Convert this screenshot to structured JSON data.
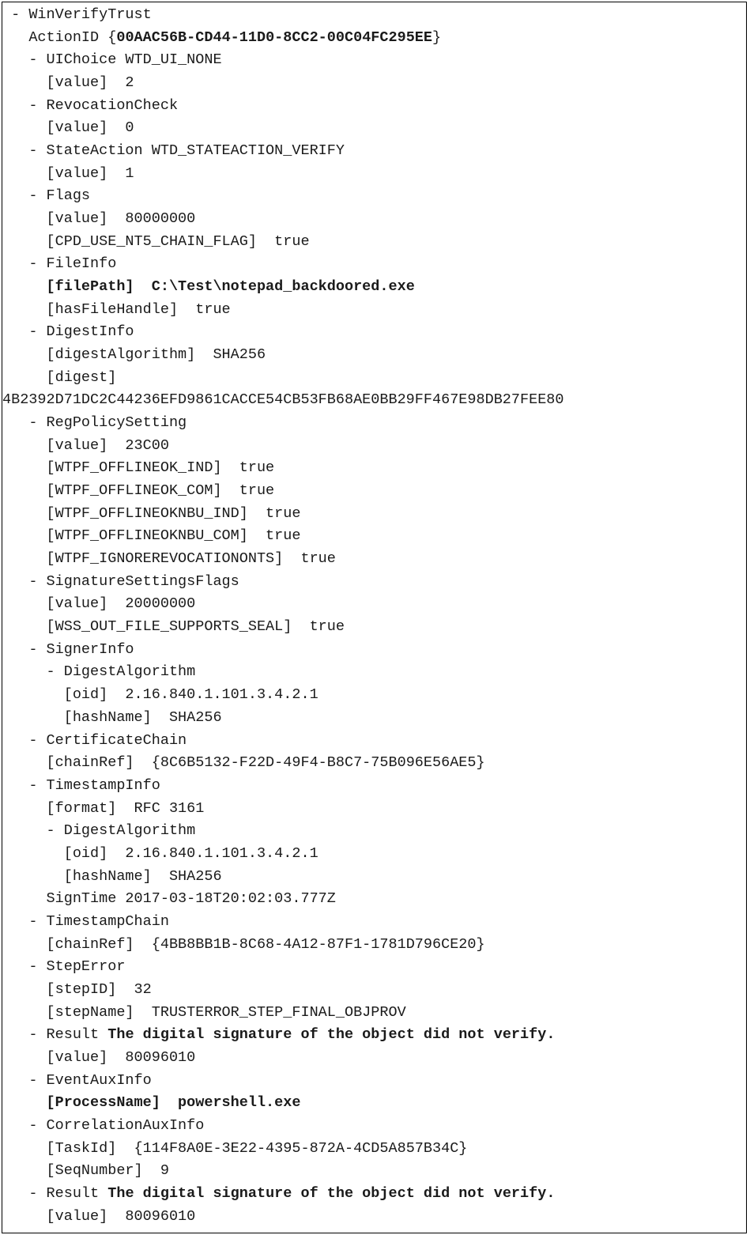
{
  "lines": [
    {
      "indent": 0,
      "segments": [
        {
          "t": "- WinVerifyTrust",
          "b": false
        }
      ]
    },
    {
      "indent": 1,
      "segments": [
        {
          "t": "ActionID {",
          "b": false
        },
        {
          "t": "00AAC56B-CD44-11D0-8CC2-00C04FC295EE",
          "b": true
        },
        {
          "t": "}",
          "b": false
        }
      ]
    },
    {
      "indent": 1,
      "segments": [
        {
          "t": "- UIChoice WTD_UI_NONE",
          "b": false
        }
      ]
    },
    {
      "indent": 2,
      "segments": [
        {
          "t": "[value]  2",
          "b": false
        }
      ]
    },
    {
      "indent": 1,
      "segments": [
        {
          "t": "- RevocationCheck",
          "b": false
        }
      ]
    },
    {
      "indent": 2,
      "segments": [
        {
          "t": "[value]  0",
          "b": false
        }
      ]
    },
    {
      "indent": 1,
      "segments": [
        {
          "t": "- StateAction WTD_STATEACTION_VERIFY",
          "b": false
        }
      ]
    },
    {
      "indent": 2,
      "segments": [
        {
          "t": "[value]  1",
          "b": false
        }
      ]
    },
    {
      "indent": 1,
      "segments": [
        {
          "t": "- Flags",
          "b": false
        }
      ]
    },
    {
      "indent": 2,
      "segments": [
        {
          "t": "[value]  80000000",
          "b": false
        }
      ]
    },
    {
      "indent": 2,
      "segments": [
        {
          "t": "[CPD_USE_NT5_CHAIN_FLAG]  true",
          "b": false
        }
      ]
    },
    {
      "indent": 1,
      "segments": [
        {
          "t": "- FileInfo",
          "b": false
        }
      ]
    },
    {
      "indent": 2,
      "segments": [
        {
          "t": "[filePath]  C:\\Test\\notepad_backdoored.exe",
          "b": true
        }
      ]
    },
    {
      "indent": 2,
      "segments": [
        {
          "t": "[hasFileHandle]  true",
          "b": false
        }
      ]
    },
    {
      "indent": 1,
      "segments": [
        {
          "t": "- DigestInfo",
          "b": false
        }
      ]
    },
    {
      "indent": 2,
      "segments": [
        {
          "t": "[digestAlgorithm]  SHA256",
          "b": false
        }
      ]
    },
    {
      "indent": 2,
      "segments": [
        {
          "t": "[digest]",
          "b": false
        }
      ]
    },
    {
      "indent": -1,
      "segments": [
        {
          "t": "4B2392D71DC2C44236EFD9861CACCE54CB53FB68AE0BB29FF467E98DB27FEE80",
          "b": false
        }
      ]
    },
    {
      "indent": 1,
      "segments": [
        {
          "t": "- RegPolicySetting",
          "b": false
        }
      ]
    },
    {
      "indent": 2,
      "segments": [
        {
          "t": "[value]  23C00",
          "b": false
        }
      ]
    },
    {
      "indent": 2,
      "segments": [
        {
          "t": "[WTPF_OFFLINEOK_IND]  true",
          "b": false
        }
      ]
    },
    {
      "indent": 2,
      "segments": [
        {
          "t": "[WTPF_OFFLINEOK_COM]  true",
          "b": false
        }
      ]
    },
    {
      "indent": 2,
      "segments": [
        {
          "t": "[WTPF_OFFLINEOKNBU_IND]  true",
          "b": false
        }
      ]
    },
    {
      "indent": 2,
      "segments": [
        {
          "t": "[WTPF_OFFLINEOKNBU_COM]  true",
          "b": false
        }
      ]
    },
    {
      "indent": 2,
      "segments": [
        {
          "t": "[WTPF_IGNOREREVOCATIONONTS]  true",
          "b": false
        }
      ]
    },
    {
      "indent": 1,
      "segments": [
        {
          "t": "- SignatureSettingsFlags",
          "b": false
        }
      ]
    },
    {
      "indent": 2,
      "segments": [
        {
          "t": "[value]  20000000",
          "b": false
        }
      ]
    },
    {
      "indent": 2,
      "segments": [
        {
          "t": "[WSS_OUT_FILE_SUPPORTS_SEAL]  true",
          "b": false
        }
      ]
    },
    {
      "indent": 1,
      "segments": [
        {
          "t": "- SignerInfo",
          "b": false
        }
      ]
    },
    {
      "indent": 2,
      "segments": [
        {
          "t": "- DigestAlgorithm",
          "b": false
        }
      ]
    },
    {
      "indent": 3,
      "segments": [
        {
          "t": "[oid]  2.16.840.1.101.3.4.2.1",
          "b": false
        }
      ]
    },
    {
      "indent": 3,
      "segments": [
        {
          "t": "[hashName]  SHA256",
          "b": false
        }
      ]
    },
    {
      "indent": 1,
      "segments": [
        {
          "t": "- CertificateChain",
          "b": false
        }
      ]
    },
    {
      "indent": 2,
      "segments": [
        {
          "t": "[chainRef]  {8C6B5132-F22D-49F4-B8C7-75B096E56AE5}",
          "b": false
        }
      ]
    },
    {
      "indent": 1,
      "segments": [
        {
          "t": "- TimestampInfo",
          "b": false
        }
      ]
    },
    {
      "indent": 2,
      "segments": [
        {
          "t": "[format]  RFC 3161",
          "b": false
        }
      ]
    },
    {
      "indent": 2,
      "segments": [
        {
          "t": "- DigestAlgorithm",
          "b": false
        }
      ]
    },
    {
      "indent": 3,
      "segments": [
        {
          "t": "[oid]  2.16.840.1.101.3.4.2.1",
          "b": false
        }
      ]
    },
    {
      "indent": 3,
      "segments": [
        {
          "t": "[hashName]  SHA256",
          "b": false
        }
      ]
    },
    {
      "indent": 2,
      "segments": [
        {
          "t": "SignTime 2017-03-18T20:02:03.777Z",
          "b": false
        }
      ]
    },
    {
      "indent": 1,
      "segments": [
        {
          "t": "- TimestampChain",
          "b": false
        }
      ]
    },
    {
      "indent": 2,
      "segments": [
        {
          "t": "[chainRef]  {4BB8BB1B-8C68-4A12-87F1-1781D796CE20}",
          "b": false
        }
      ]
    },
    {
      "indent": 1,
      "segments": [
        {
          "t": "- StepError",
          "b": false
        }
      ]
    },
    {
      "indent": 2,
      "segments": [
        {
          "t": "[stepID]  32",
          "b": false
        }
      ]
    },
    {
      "indent": 2,
      "segments": [
        {
          "t": "[stepName]  TRUSTERROR_STEP_FINAL_OBJPROV",
          "b": false
        }
      ]
    },
    {
      "indent": 1,
      "segments": [
        {
          "t": "- Result ",
          "b": false
        },
        {
          "t": "The digital signature of the object did not verify.",
          "b": true
        }
      ]
    },
    {
      "indent": 2,
      "segments": [
        {
          "t": "[value]  80096010",
          "b": false
        }
      ]
    },
    {
      "indent": 1,
      "segments": [
        {
          "t": "- EventAuxInfo",
          "b": false
        }
      ]
    },
    {
      "indent": 2,
      "segments": [
        {
          "t": "[ProcessName]  powershell.exe",
          "b": true
        }
      ]
    },
    {
      "indent": 1,
      "segments": [
        {
          "t": "- CorrelationAuxInfo",
          "b": false
        }
      ]
    },
    {
      "indent": 2,
      "segments": [
        {
          "t": "[TaskId]  {114F8A0E-3E22-4395-872A-4CD5A857B34C}",
          "b": false
        }
      ]
    },
    {
      "indent": 2,
      "segments": [
        {
          "t": "[SeqNumber]  9",
          "b": false
        }
      ]
    },
    {
      "indent": 1,
      "segments": [
        {
          "t": "- Result ",
          "b": false
        },
        {
          "t": "The digital signature of the object did not verify.",
          "b": true
        }
      ]
    },
    {
      "indent": 2,
      "segments": [
        {
          "t": "[value]  80096010",
          "b": false
        }
      ]
    }
  ],
  "indent_unit": "  "
}
